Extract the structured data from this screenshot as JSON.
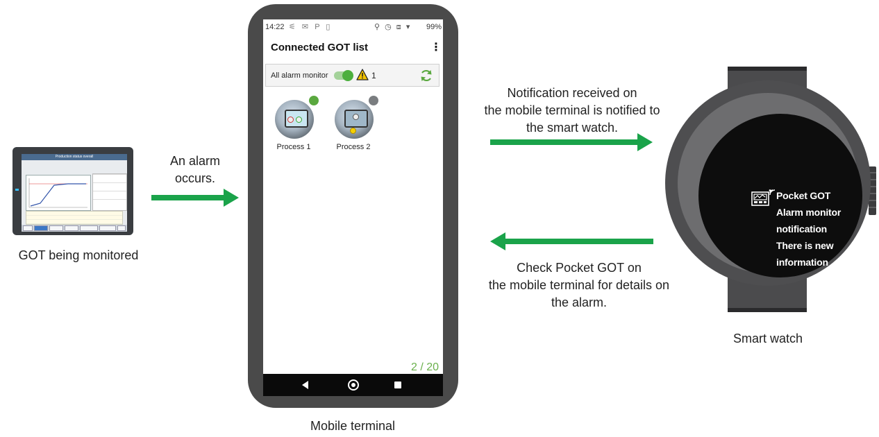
{
  "got": {
    "caption": "GOT being monitored",
    "screen_title": "Production status overall"
  },
  "arrow_alarm": {
    "line1": "An alarm",
    "line2": "occurs."
  },
  "phone": {
    "caption": "Mobile terminal",
    "status_time": "14:22",
    "status_battery": "99%",
    "app_title": "Connected GOT list",
    "menu_icon": "kebab-menu-icon",
    "monitor_label": "All alarm monitor",
    "monitor_enabled": true,
    "alarm_count": "1",
    "gots": [
      {
        "label": "Process 1",
        "status": "connected",
        "status_color": "#5aa83f"
      },
      {
        "label": "Process 2",
        "status": "disconnected",
        "status_color": "#7a7d80"
      }
    ],
    "page_counter": "2 / 20",
    "nav": [
      "back-icon",
      "home-icon",
      "recents-icon"
    ]
  },
  "notify_text": {
    "line1": "Notification received on",
    "line2": "the mobile terminal is notified to",
    "line3": "the smart watch."
  },
  "check_text": {
    "line1": "Check Pocket GOT on",
    "line2": "the mobile terminal for details on",
    "line3": "the alarm."
  },
  "watch": {
    "caption": "Smart watch",
    "notification": [
      "Pocket GOT",
      "Alarm monitor",
      "notification",
      "There is new",
      "information"
    ]
  },
  "colors": {
    "arrow": "#1aa34a",
    "device_body": "#4a4a4a",
    "accent_green": "#6ab04c"
  }
}
